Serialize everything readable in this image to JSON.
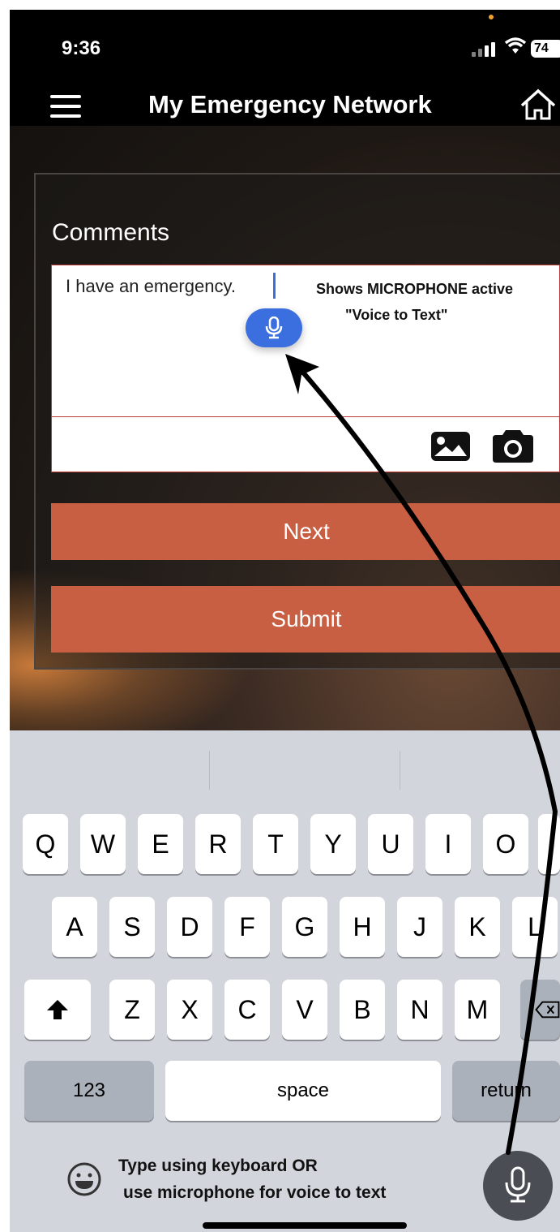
{
  "status_bar": {
    "time": "9:36",
    "battery": "74"
  },
  "header": {
    "title": "My Emergency Network"
  },
  "form": {
    "comments_label": "Comments",
    "comment_value": "I have an emergency.",
    "annotation_line1": "Shows MICROPHONE active",
    "annotation_line2": "\"Voice to Text\"",
    "next_label": "Next",
    "submit_label": "Submit"
  },
  "keyboard": {
    "row1": [
      "Q",
      "W",
      "E",
      "R",
      "T",
      "Y",
      "U",
      "I",
      "O"
    ],
    "row2": [
      "A",
      "S",
      "D",
      "F",
      "G",
      "H",
      "J",
      "K",
      "L"
    ],
    "row3": [
      "Z",
      "X",
      "C",
      "V",
      "B",
      "N",
      "M"
    ],
    "numbers_label": "123",
    "space_label": "space",
    "return_label": "return"
  },
  "footer": {
    "hint_line1": "Type using keyboard OR",
    "hint_line2": "use microphone for voice to text"
  },
  "colors": {
    "accent_button": "#c85e42",
    "mic_active": "#3b6fe0",
    "keyboard_bg": "#d2d5db"
  }
}
